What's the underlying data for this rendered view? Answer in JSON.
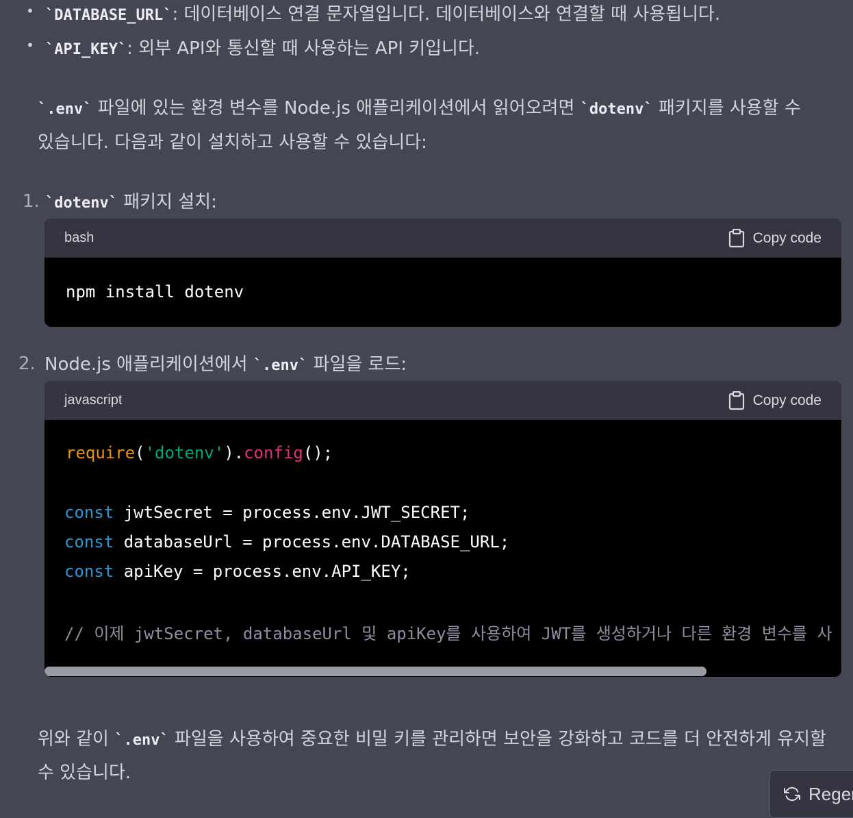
{
  "env_vars": [
    {
      "name": "`DATABASE_URL`",
      "desc": ": 데이터베이스 연결 문자열입니다. 데이터베이스와 연결할 때 사용됩니다."
    },
    {
      "name": "`API_KEY`",
      "desc": ": 외부 API와 통신할 때 사용하는 API 키입니다."
    }
  ],
  "intro": {
    "code1": "`.env`",
    "text1": " 파일에 있는 환경 변수를 Node.js 애플리케이션에서 읽어오려면 ",
    "code2": "`dotenv`",
    "text2": " 패키지를 사용할 수",
    "line2": "있습니다. 다음과 같이 설치하고 사용할 수 있습니다:"
  },
  "steps": [
    {
      "num": "1.",
      "code": "`dotenv`",
      "text_after": " 패키지 설치:"
    },
    {
      "num": "2.",
      "text_before": "Node.js 애플리케이션에서 ",
      "code": "`.env`",
      "text_after": " 파일을 로드:"
    }
  ],
  "code_blocks": [
    {
      "lang": "bash",
      "copy_label": "Copy code",
      "lines": [
        "npm install dotenv"
      ]
    },
    {
      "lang": "javascript",
      "copy_label": "Copy code",
      "require": {
        "fn": "require",
        "open": "(",
        "str": "'dotenv'",
        "mid": ").",
        "method": "config",
        "end": "();"
      },
      "decls": [
        {
          "kw": "const",
          "rest": " jwtSecret = process.env.JWT_SECRET;"
        },
        {
          "kw": "const",
          "rest": " databaseUrl = process.env.DATABASE_URL;"
        },
        {
          "kw": "const",
          "rest": " apiKey = process.env.API_KEY;"
        }
      ],
      "comment": "// 이제 jwtSecret, databaseUrl 및 apiKey를 사용하여 JWT를 생성하거나 다른 환경 변수를 사"
    }
  ],
  "conclusion": {
    "text1": "위와 같이 ",
    "code": "`.env`",
    "text2": " 파일을 사용하여 중요한 비밀 키를 관리하면 보안을 강화하고 코드를 더 안전하게 유지할",
    "line2": "수 있습니다."
  },
  "regenerate_label": "Regen",
  "colors": {
    "background": "#444654",
    "code_bg": "#000000",
    "header_bg": "#343541",
    "keyword": "#2e95d3",
    "function": "#e9950c",
    "string": "#00a67d",
    "method": "#df3079",
    "comment": "#8e8ea0"
  },
  "icons": [
    "copy-icon",
    "regenerate-icon"
  ]
}
